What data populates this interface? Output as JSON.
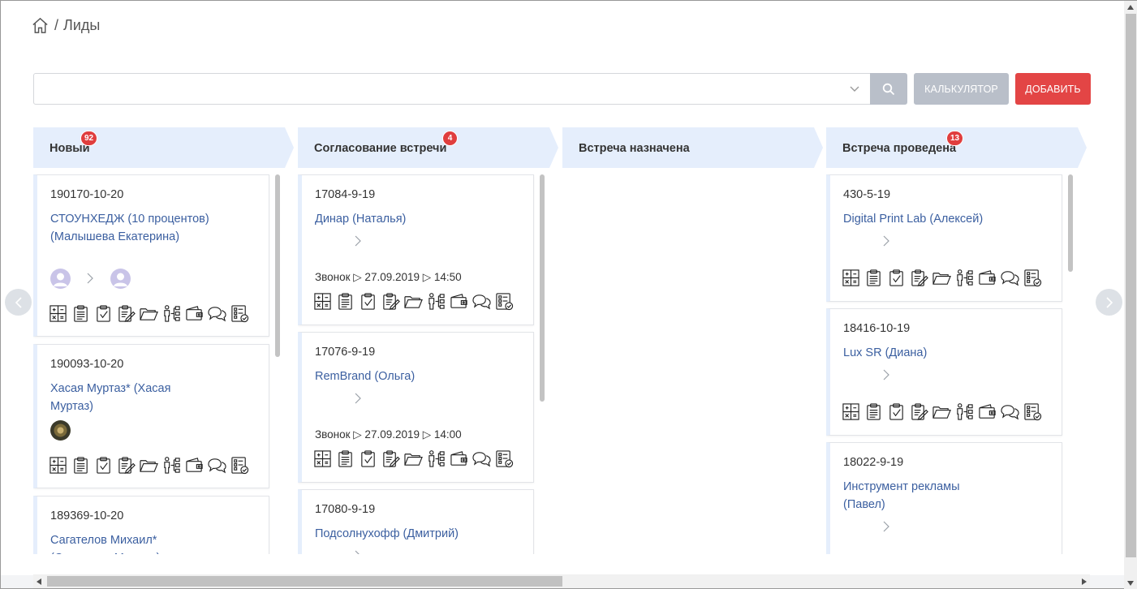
{
  "breadcrumb": {
    "separator": "/",
    "current": "Лиды"
  },
  "toolbar": {
    "search_value": "",
    "calc_label": "КАЛЬКУЛЯТОР",
    "add_label": "ДОБАВИТЬ"
  },
  "stages": [
    {
      "label": "Новый",
      "badge": "92"
    },
    {
      "label": "Согласование встречи",
      "badge": "4"
    },
    {
      "label": "Встреча назначена",
      "badge": ""
    },
    {
      "label": "Встреча проведена",
      "badge": "13"
    }
  ],
  "columns": [
    {
      "cards": [
        {
          "number": "190170-10-20",
          "title": "СТОУНХЕДЖ (10 процентов) (Малышева Екатерина)"
        },
        {
          "number": "190093-10-20",
          "title": "Хасая Муртаз* (Хасая Муртаз)"
        },
        {
          "number": "189369-10-20",
          "title": "Сагателов Михаил* (Сагателов Михаил)"
        }
      ]
    },
    {
      "cards": [
        {
          "number": "17084-9-19",
          "title": "Динар (Наталья)",
          "call": "Звонок ▷ 27.09.2019 ▷ 14:50"
        },
        {
          "number": "17076-9-19",
          "title": "RemBrand (Ольга)",
          "call": "Звонок ▷ 27.09.2019 ▷ 14:00"
        },
        {
          "number": "17080-9-19",
          "title": "Подсолнухофф (Дмитрий)"
        }
      ]
    },
    {
      "cards": []
    },
    {
      "cards": [
        {
          "number": "430-5-19",
          "title": "Digital Print Lab (Алексей)"
        },
        {
          "number": "18416-10-19",
          "title": "Lux SR (Диана)"
        },
        {
          "number": "18022-9-19",
          "title": "Инструмент рекламы (Павел)"
        }
      ]
    }
  ],
  "card_icons": [
    "calculator-icon",
    "clipboard-icon",
    "task-check-icon",
    "edit-document-icon",
    "folder-icon",
    "org-structure-icon",
    "wallet-icon",
    "chat-icon",
    "checklist-icon"
  ],
  "colors": {
    "accent_red": "#e34545",
    "link_blue": "#3b5fa0",
    "stage_bg": "#e5eefc",
    "button_gray": "#b9bfc9"
  }
}
